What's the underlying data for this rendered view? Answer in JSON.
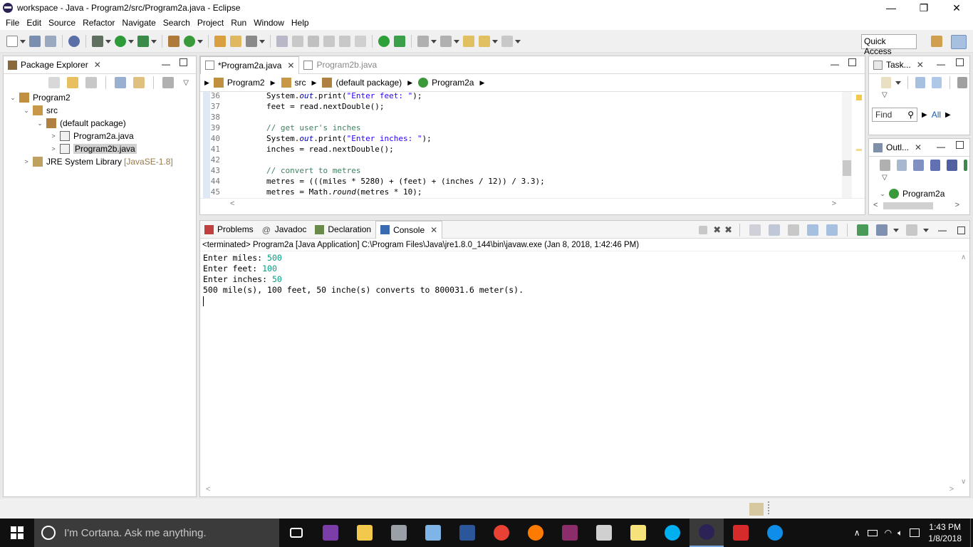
{
  "window": {
    "title": "workspace - Java - Program2/src/Program2a.java - Eclipse",
    "minimize": "—",
    "restore": "❐",
    "close": "✕"
  },
  "menu": [
    "File",
    "Edit",
    "Source",
    "Refactor",
    "Navigate",
    "Search",
    "Project",
    "Run",
    "Window",
    "Help"
  ],
  "toolbar": {
    "quick_access": "Quick Access"
  },
  "package_explorer": {
    "tab_label": "Package Explorer",
    "tree": [
      {
        "label": "Program2",
        "indent": 0,
        "twisty": "⌄",
        "icon": "project-icon"
      },
      {
        "label": "src",
        "indent": 1,
        "twisty": "⌄",
        "icon": "source-folder-icon"
      },
      {
        "label": "(default package)",
        "indent": 2,
        "twisty": "⌄",
        "icon": "package-icon"
      },
      {
        "label": "Program2a.java",
        "indent": 3,
        "twisty": ">",
        "icon": "java-file-icon"
      },
      {
        "label": "Program2b.java",
        "indent": 3,
        "twisty": ">",
        "icon": "java-file-icon",
        "selected": true
      },
      {
        "label": "JRE System Library",
        "suffix": "[JavaSE-1.8]",
        "indent": 1,
        "twisty": ">",
        "icon": "library-icon"
      }
    ]
  },
  "editor": {
    "tabs": [
      {
        "label": "*Program2a.java",
        "active": true
      },
      {
        "label": "Program2b.java",
        "active": false
      }
    ],
    "breadcrumb": [
      "Program2",
      "src",
      "(default package)",
      "Program2a"
    ],
    "lines": [
      {
        "n": "36",
        "html": "        System.<span class=\"fi\">out</span>.print(<span class=\"st\">\"Enter feet: \"</span>);"
      },
      {
        "n": "37",
        "html": "        feet = read.nextDouble();"
      },
      {
        "n": "38",
        "html": ""
      },
      {
        "n": "39",
        "html": "        <span class=\"cm\">// get user's inches</span>"
      },
      {
        "n": "40",
        "html": "        System.<span class=\"fi\">out</span>.print(<span class=\"st\">\"Enter inches: \"</span>);"
      },
      {
        "n": "41",
        "html": "        inches = read.nextDouble();"
      },
      {
        "n": "42",
        "html": ""
      },
      {
        "n": "43",
        "html": "        <span class=\"cm\">// convert to metres</span>"
      },
      {
        "n": "44",
        "html": "        metres = (((miles * 5280) + (feet) + (inches / 12)) / 3.3);"
      },
      {
        "n": "45",
        "html": "        metres = Math.<span class=\"mi\">round</span>(metres * 10);"
      }
    ]
  },
  "tasks": {
    "tab_label": "Task...",
    "find_placeholder": "Find",
    "all_label": "All"
  },
  "outline": {
    "tab_label": "Outl...",
    "item": "Program2a"
  },
  "bottom": {
    "tabs": [
      {
        "label": "Problems",
        "icon": "problems-icon",
        "active": false
      },
      {
        "label": "Javadoc",
        "icon": "javadoc-icon",
        "active": false
      },
      {
        "label": "Declaration",
        "icon": "declaration-icon",
        "active": false
      },
      {
        "label": "Console",
        "icon": "console-icon",
        "active": true
      }
    ],
    "terminated": "<terminated> Program2a [Java Application] C:\\Program Files\\Java\\jre1.8.0_144\\bin\\javaw.exe (Jan 8, 2018, 1:42:46 PM)",
    "console": [
      {
        "prompt": "Enter miles: ",
        "input": "500"
      },
      {
        "prompt": "Enter feet: ",
        "input": "100"
      },
      {
        "prompt": "Enter inches: ",
        "input": "50"
      },
      {
        "prompt": "500 mile(s), 100 feet, 50 inche(s) converts to 800031.6 meter(s).",
        "input": ""
      }
    ]
  },
  "taskbar": {
    "cortana": "I'm Cortana. Ask me anything.",
    "time": "1:43 PM",
    "date": "1/8/2018",
    "apps": [
      {
        "name": "task-view-icon",
        "color": "#ffffff"
      },
      {
        "name": "onenote-icon",
        "color": "#7b3ea8"
      },
      {
        "name": "file-explorer-icon",
        "color": "#f2c94c"
      },
      {
        "name": "paint-icon",
        "color": "#9aa0a6"
      },
      {
        "name": "notepad-icon",
        "color": "#7fb5e6"
      },
      {
        "name": "word-icon",
        "color": "#2b579a"
      },
      {
        "name": "chrome-icon",
        "color": "#e94235"
      },
      {
        "name": "firefox-icon",
        "color": "#ff7b00"
      },
      {
        "name": "winrar-icon",
        "color": "#8b2d6b"
      },
      {
        "name": "snipping-tool-icon",
        "color": "#d0d0d0"
      },
      {
        "name": "sticky-notes-icon",
        "color": "#f5e27a"
      },
      {
        "name": "skype-icon",
        "color": "#00aff0"
      },
      {
        "name": "eclipse-icon",
        "color": "#2c2255"
      },
      {
        "name": "acrobat-icon",
        "color": "#d62b2b"
      },
      {
        "name": "teamviewer-icon",
        "color": "#0e8ee9"
      }
    ]
  }
}
